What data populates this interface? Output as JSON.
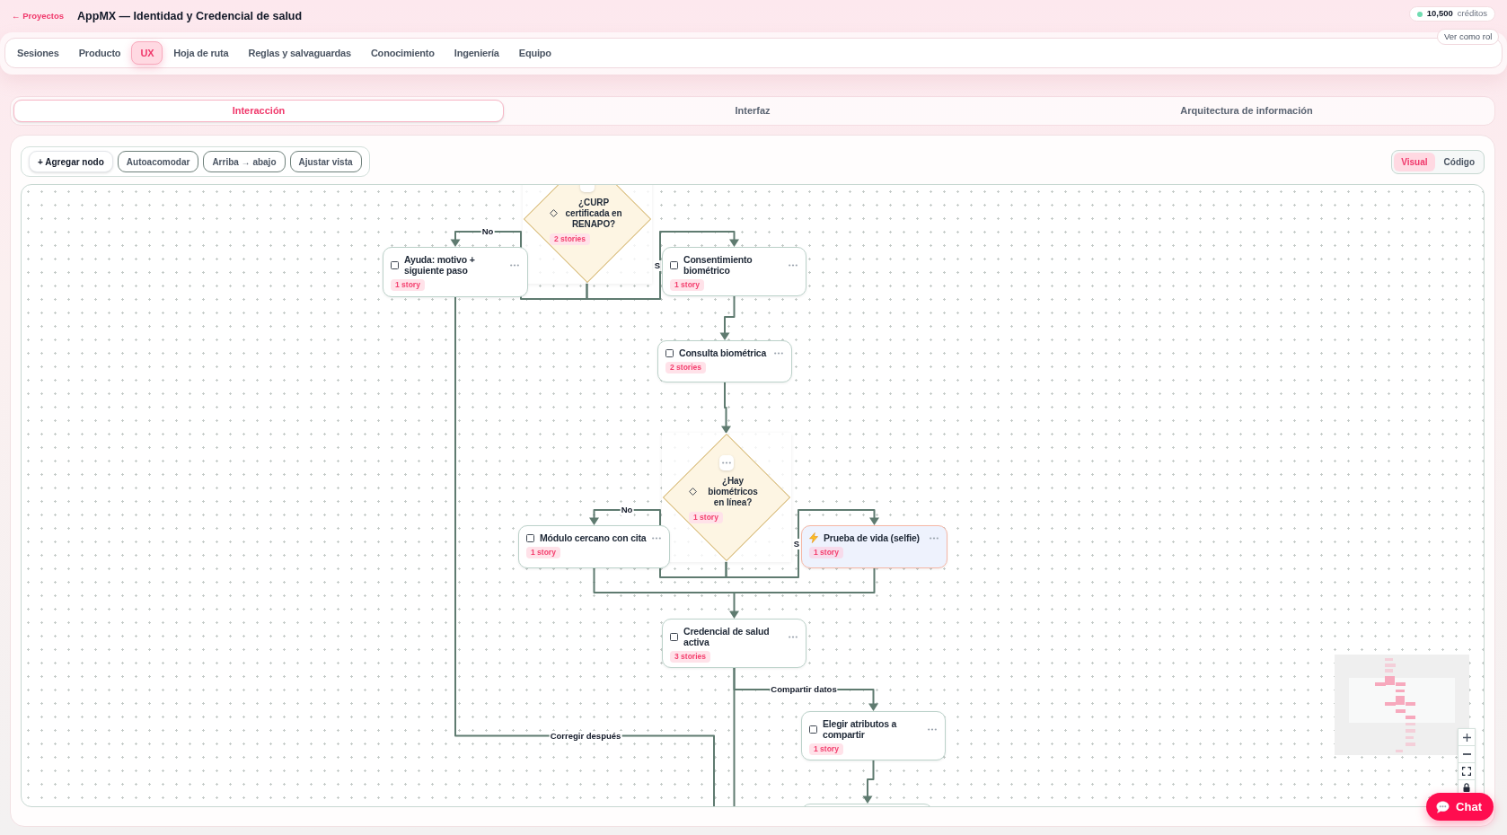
{
  "header": {
    "back_link": "← Proyectos",
    "title": "AppMX — Identidad y Credencial de salud",
    "credits": {
      "amount": "10,500",
      "label": "créditos"
    },
    "view_as_button": "Ver como rol"
  },
  "nav_tabs": [
    {
      "label": "Sesiones",
      "selected": false
    },
    {
      "label": "Producto",
      "selected": false
    },
    {
      "label": "UX",
      "selected": true
    },
    {
      "label": "Hoja de ruta",
      "selected": false
    },
    {
      "label": "Reglas y salvaguardas",
      "selected": false
    },
    {
      "label": "Conocimiento",
      "selected": false
    },
    {
      "label": "Ingeniería",
      "selected": false
    },
    {
      "label": "Equipo",
      "selected": false
    }
  ],
  "sub_tabs": [
    {
      "label": "Interacción",
      "selected": true
    },
    {
      "label": "Interfaz",
      "selected": false
    },
    {
      "label": "Arquitectura de información",
      "selected": false
    }
  ],
  "toolbar": {
    "buttons": [
      {
        "label": "+ Agregar nodo",
        "kind": "primary"
      },
      {
        "label": "Autoacomodar",
        "kind": "outline"
      },
      {
        "label": "Arriba → abajo",
        "kind": "outline"
      },
      {
        "label": "Ajustar vista",
        "kind": "outline"
      }
    ]
  },
  "view_toggle": [
    {
      "label": "Visual",
      "selected": true
    },
    {
      "label": "Código",
      "selected": false
    }
  ],
  "canvas": {
    "nodes": [
      {
        "kind": "decision",
        "title": "¿CURP certificada en RENAPO?",
        "badge": "2 stories"
      },
      {
        "kind": "step",
        "title": "Ayuda: motivo + siguiente paso",
        "badge": "1 story"
      },
      {
        "kind": "step",
        "title": "Consentimiento biométrico",
        "badge": "1 story"
      },
      {
        "kind": "step",
        "title": "Consulta biométrica",
        "badge": "2 stories"
      },
      {
        "kind": "decision",
        "title": "¿Hay biométricos en línea?",
        "badge": "1 story"
      },
      {
        "kind": "step",
        "title": "Módulo cercano con cita",
        "badge": "1 story"
      },
      {
        "kind": "action",
        "title": "Prueba de vida (selfie)",
        "badge": "1 story"
      },
      {
        "kind": "step",
        "title": "Credencial de salud activa",
        "badge": "3 stories"
      },
      {
        "kind": "step",
        "title": "Elegir atributos a compartir",
        "badge": "1 story"
      }
    ],
    "edge_labels": [
      {
        "text": "No"
      },
      {
        "text": "S"
      },
      {
        "text": "No"
      },
      {
        "text": "S"
      },
      {
        "text": "Compartir datos"
      },
      {
        "text": "Corregir después"
      }
    ]
  },
  "chat_button": {
    "label": "Chat"
  }
}
